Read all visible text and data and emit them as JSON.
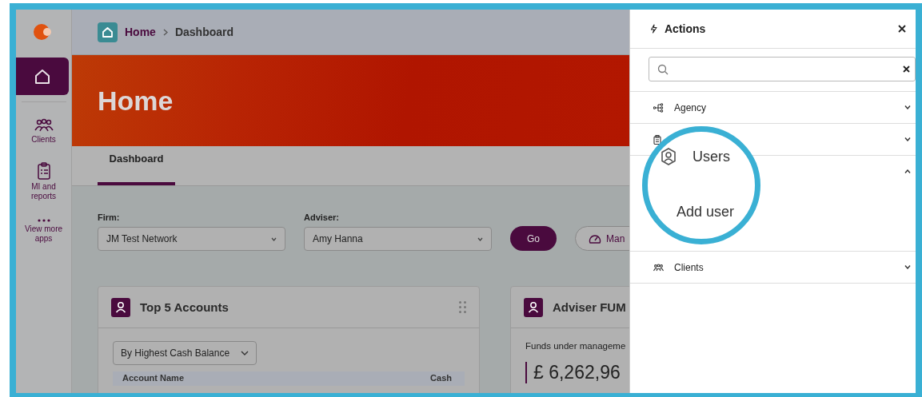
{
  "sidebar": {
    "items": [
      {
        "kind": "home",
        "selected": true
      },
      {
        "kind": "clients",
        "label": "Clients",
        "selected": false
      },
      {
        "kind": "reports",
        "label": "MI and reports",
        "selected": false
      },
      {
        "kind": "more",
        "label": "View more apps",
        "selected": false
      }
    ]
  },
  "breadcrumb": [
    "Home",
    "Dashboard"
  ],
  "hero": {
    "title": "Home"
  },
  "tabs": [
    {
      "label": "Dashboard",
      "selected": true
    }
  ],
  "filters": [
    {
      "label": "Firm:",
      "value": "JM Test Network"
    },
    {
      "label": "Adviser:",
      "value": "Amy Hanna"
    }
  ],
  "buttons": [
    {
      "kind": "primary",
      "label": "Go"
    },
    {
      "kind": "outline",
      "label": "Man"
    }
  ],
  "cards": [
    {
      "kind": "accounts",
      "title": "Top 5 Accounts",
      "dropdown": "By Highest Cash Balance",
      "columns": [
        "Account Name",
        "Cash"
      ]
    },
    {
      "kind": "fum",
      "title": "Adviser FUM",
      "subtitle": "Funds under manageme",
      "amount": "£ 6,262,96"
    }
  ],
  "actions_panel": {
    "title": "Actions",
    "sections": [
      {
        "kind": "agency",
        "label": "Agency",
        "expanded": false
      },
      {
        "kind": "clipboard",
        "expanded": false
      },
      {
        "kind": "users",
        "expanded": true
      },
      {
        "kind": "clients",
        "label": "Clients",
        "expanded": false
      }
    ]
  },
  "callout": {
    "title": "Users",
    "item": "Add user"
  }
}
